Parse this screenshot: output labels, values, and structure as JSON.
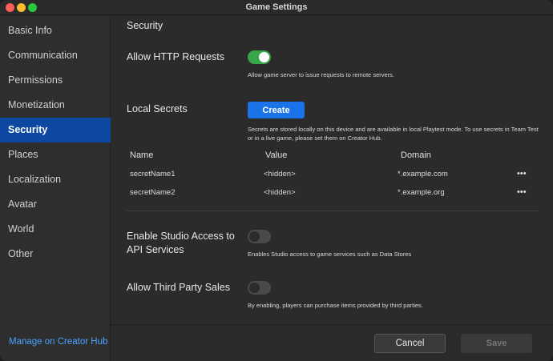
{
  "window": {
    "title": "Game Settings"
  },
  "sidebar": {
    "items": [
      {
        "label": "Basic Info"
      },
      {
        "label": "Communication"
      },
      {
        "label": "Permissions"
      },
      {
        "label": "Monetization"
      },
      {
        "label": "Security"
      },
      {
        "label": "Places"
      },
      {
        "label": "Localization"
      },
      {
        "label": "Avatar"
      },
      {
        "label": "World"
      },
      {
        "label": "Other"
      }
    ],
    "active": "Security",
    "manage_link": "Manage on Creator Hub"
  },
  "main": {
    "section_title": "Security",
    "http": {
      "label": "Allow HTTP Requests",
      "enabled": true,
      "help": "Allow game server to issue requests to remote servers."
    },
    "secrets": {
      "label": "Local Secrets",
      "create_label": "Create",
      "help": "Secrets are stored locally on this device and are available in local Playtest mode. To use secrets in Team Test or in a live game, please set them on Creator Hub.",
      "columns": [
        "Name",
        "Value",
        "Domain"
      ],
      "rows": [
        {
          "name": "secretName1",
          "value": "<hidden>",
          "domain": "*.example.com",
          "menu": "•••"
        },
        {
          "name": "secretName2",
          "value": "<hidden>",
          "domain": "*.example.org",
          "menu": "•••"
        }
      ]
    },
    "studio_access": {
      "label_line1": "Enable Studio Access to",
      "label_line2": "API Services",
      "enabled": false,
      "help": "Enables Studio access to game services such as Data Stores"
    },
    "third_party": {
      "label": "Allow Third Party Sales",
      "enabled": false,
      "help": "By enabling, players can purchase items provided by third parties."
    }
  },
  "footer": {
    "cancel_label": "Cancel",
    "save_label": "Save"
  },
  "colors": {
    "accent": "#1a73e8",
    "active_nav": "#0d47a1",
    "toggle_on": "#3aa64a",
    "link": "#4aa3ff"
  }
}
